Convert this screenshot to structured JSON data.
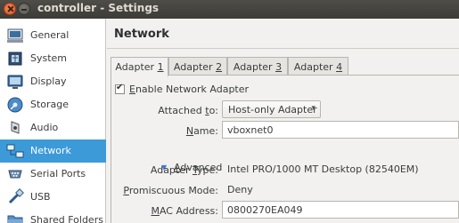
{
  "window": {
    "title": "controller - Settings"
  },
  "sidebar": {
    "items": [
      {
        "label": "General",
        "icon": "general-icon"
      },
      {
        "label": "System",
        "icon": "system-chip-icon"
      },
      {
        "label": "Display",
        "icon": "display-monitor-icon"
      },
      {
        "label": "Storage",
        "icon": "storage-disk-icon"
      },
      {
        "label": "Audio",
        "icon": "audio-speaker-icon"
      },
      {
        "label": "Network",
        "icon": "network-icon",
        "selected": true
      },
      {
        "label": "Serial Ports",
        "icon": "serial-port-icon"
      },
      {
        "label": "USB",
        "icon": "usb-icon"
      },
      {
        "label": "Shared Folders",
        "icon": "shared-folder-icon"
      }
    ]
  },
  "page": {
    "title": "Network"
  },
  "tabs": [
    {
      "text": "Adapter ",
      "key": "1",
      "active": true
    },
    {
      "text": "Adapter ",
      "key": "2"
    },
    {
      "text": "Adapter ",
      "key": "3"
    },
    {
      "text": "Adapter ",
      "key": "4"
    }
  ],
  "adapter": {
    "enable_prefix": "",
    "enable_key": "E",
    "enable_rest": "nable Network Adapter",
    "enabled": true,
    "attached_pre": "Attached ",
    "attached_key": "t",
    "attached_post": "o:",
    "attached_value": "Host-only Adapter",
    "name_key": "N",
    "name_post": "ame:",
    "name_value": "vboxnet0",
    "advanced_key": "A",
    "advanced_post": "dvanced",
    "type_pre": "Adapter ",
    "type_key": "T",
    "type_post": "ype:",
    "type_value": "Intel PRO/1000 MT Desktop (82540EM)",
    "promisc_key": "P",
    "promisc_post": "romiscuous Mode:",
    "promisc_value": "Deny",
    "mac_key": "M",
    "mac_post": "AC Address:",
    "mac_value": "0800270EA049"
  },
  "colors": {
    "accent": "#3d9ad8",
    "titlebar": "#3c3b37",
    "close": "#e1531e"
  }
}
